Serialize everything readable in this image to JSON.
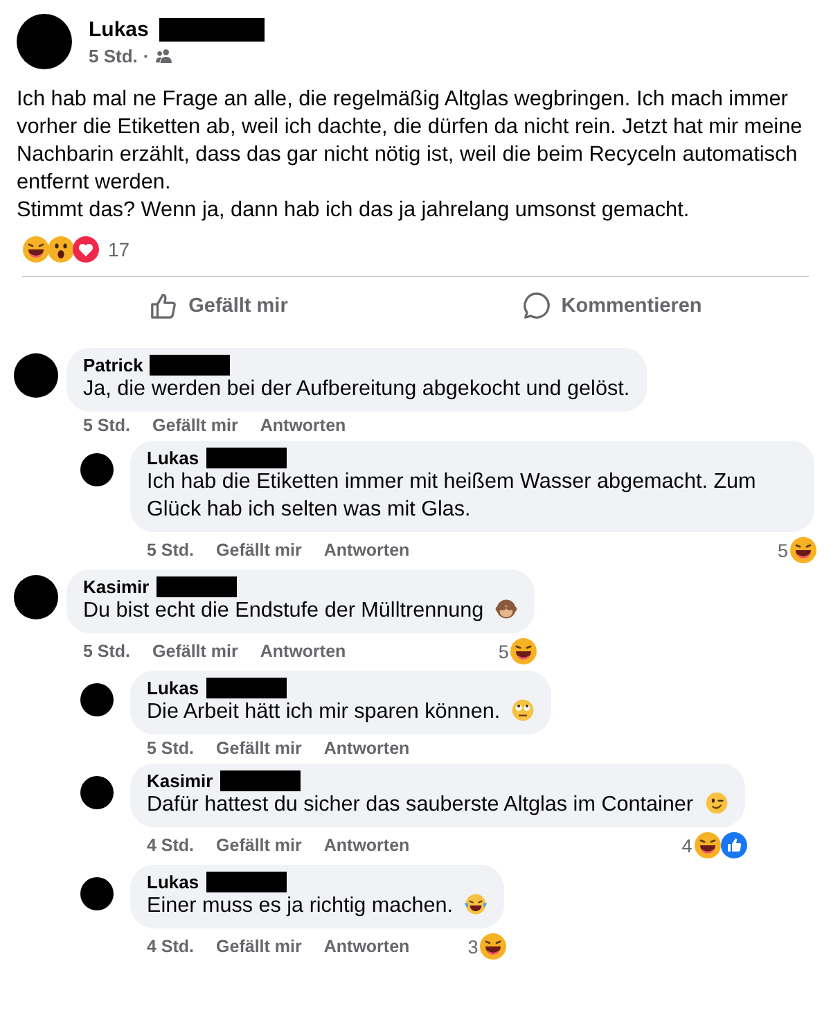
{
  "post": {
    "author": "Lukas",
    "name_redacted": true,
    "time": "5 Std.",
    "separator": "·",
    "text": "Ich hab mal ne Frage an alle, die regelmäßig Altglas wegbringen. Ich mach immer vorher die Etiketten ab, weil ich dachte, die dürfen da nicht rein. Jetzt hat mir meine Nachbarin erzählt, dass das gar nicht nötig ist, weil die beim Recyceln automatisch entfernt werden.\nStimmt das? Wenn ja, dann hab ich das ja jahrelang umsonst gemacht.",
    "reactions": [
      {
        "kind": "laugh"
      },
      {
        "kind": "wow"
      },
      {
        "kind": "love"
      }
    ],
    "reaction_count": "17"
  },
  "actions": [
    {
      "kind": "like",
      "label": "Gefällt mir"
    },
    {
      "kind": "comment",
      "label": "Kommentieren"
    }
  ],
  "comments": [
    {
      "author": "Patrick",
      "name_redacted": true,
      "text": "Ja, die werden bei der Aufbereitung abgekocht und gelöst.",
      "time": "5 Std.",
      "like_label": "Gefällt mir",
      "reply_label": "Antworten",
      "children": [
        {
          "author": "Lukas",
          "name_redacted": true,
          "text": "Ich hab die Etiketten immer mit heißem Wasser abgemacht. Zum Glück hab ich selten was mit Glas.",
          "time": "5 Std.",
          "like_label": "Gefällt mir",
          "reply_label": "Antworten",
          "reaction_count": "5",
          "reactions": [
            {
              "kind": "laugh"
            }
          ]
        }
      ]
    },
    {
      "author": "Kasimir",
      "name_redacted": true,
      "text": "Du bist echt die Endstufe der Mülltrennung",
      "emoji": {
        "kind": "monkey"
      },
      "time": "5 Std.",
      "like_label": "Gefällt mir",
      "reply_label": "Antworten",
      "reaction_count": "5",
      "reactions": [
        {
          "kind": "laugh"
        }
      ],
      "children": [
        {
          "author": "Lukas",
          "name_redacted": true,
          "text": "Die Arbeit hätt ich mir sparen können.",
          "emoji": {
            "kind": "eyeroll"
          },
          "time": "5 Std.",
          "like_label": "Gefällt mir",
          "reply_label": "Antworten"
        },
        {
          "author": "Kasimir",
          "name_redacted": true,
          "text": "Dafür hattest du sicher das sauberste Altglas im Container",
          "emoji": {
            "kind": "wink"
          },
          "time": "4 Std.",
          "like_label": "Gefällt mir",
          "reply_label": "Antworten",
          "reaction_count": "4",
          "reactions": [
            {
              "kind": "laugh"
            },
            {
              "kind": "like"
            }
          ]
        },
        {
          "author": "Lukas",
          "name_redacted": true,
          "text": "Einer muss es ja richtig machen.",
          "emoji": {
            "kind": "tears"
          },
          "time": "4 Std.",
          "like_label": "Gefällt mir",
          "reply_label": "Antworten",
          "reaction_count": "3",
          "reactions": [
            {
              "kind": "laugh"
            }
          ]
        }
      ]
    }
  ]
}
